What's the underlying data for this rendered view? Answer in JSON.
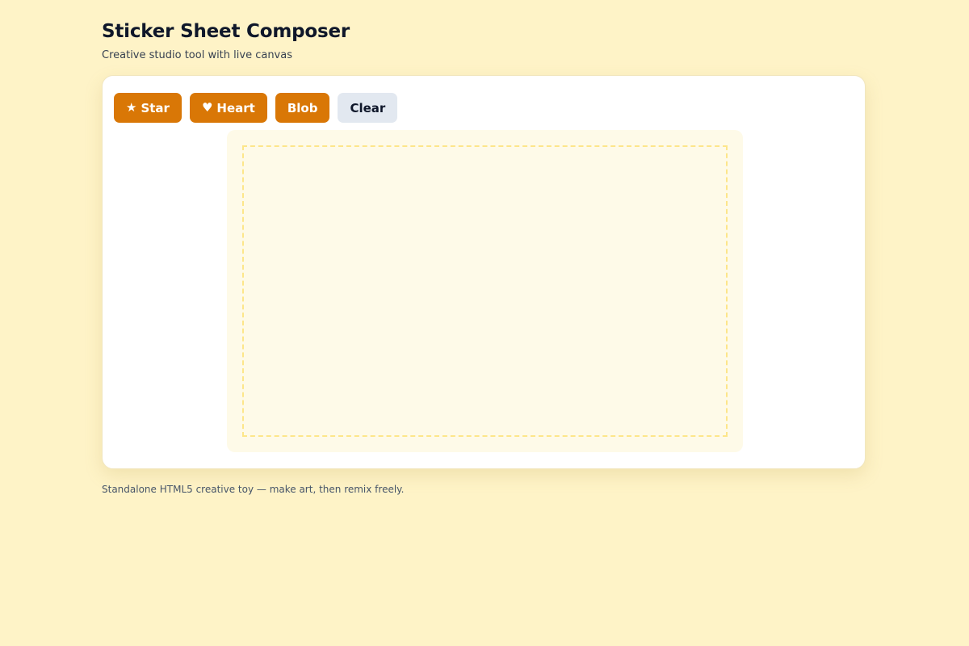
{
  "header": {
    "title": "Sticker Sheet Composer",
    "subtitle": "Creative studio tool with live canvas"
  },
  "toolbar": {
    "star": {
      "icon": "★",
      "icon_name": "star-icon",
      "label": "Star"
    },
    "heart": {
      "icon": "♥",
      "icon_name": "heart-icon",
      "label": "Heart"
    },
    "blob": {
      "label": "Blob"
    },
    "clear": {
      "label": "Clear"
    }
  },
  "footer": {
    "text": "Standalone HTML5 creative toy — make art, then remix freely."
  },
  "colors": {
    "background": "#fef3c7",
    "accent": "#d97706",
    "secondary_button": "#e2e8f0",
    "canvas_fill": "#fefae8",
    "canvas_border": "#fde68a"
  }
}
